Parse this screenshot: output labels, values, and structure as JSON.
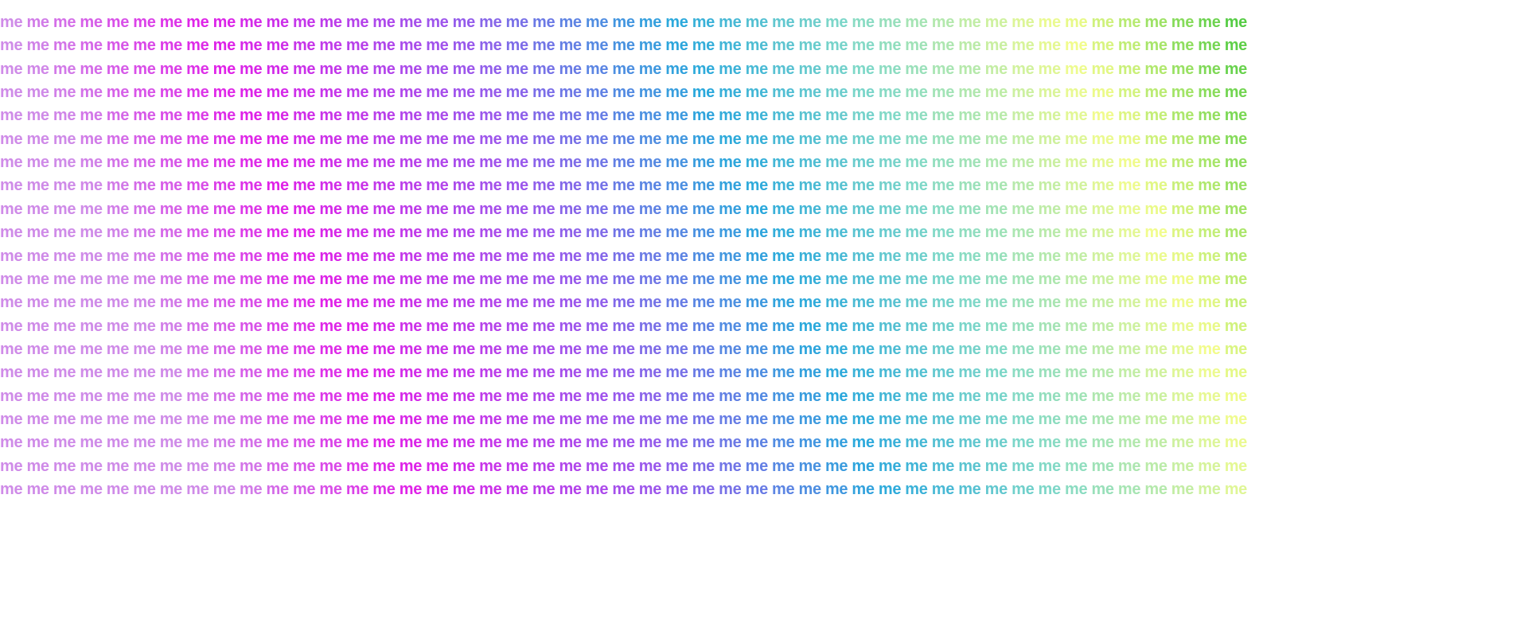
{
  "pattern": {
    "word": "me",
    "rows": 21,
    "cols": 47,
    "palette": [
      "#cf8be8",
      "#e020e8",
      "#9a58ec",
      "#2aa8dc",
      "#7fd8c8",
      "#f2fc8c",
      "#55cc44"
    ]
  }
}
